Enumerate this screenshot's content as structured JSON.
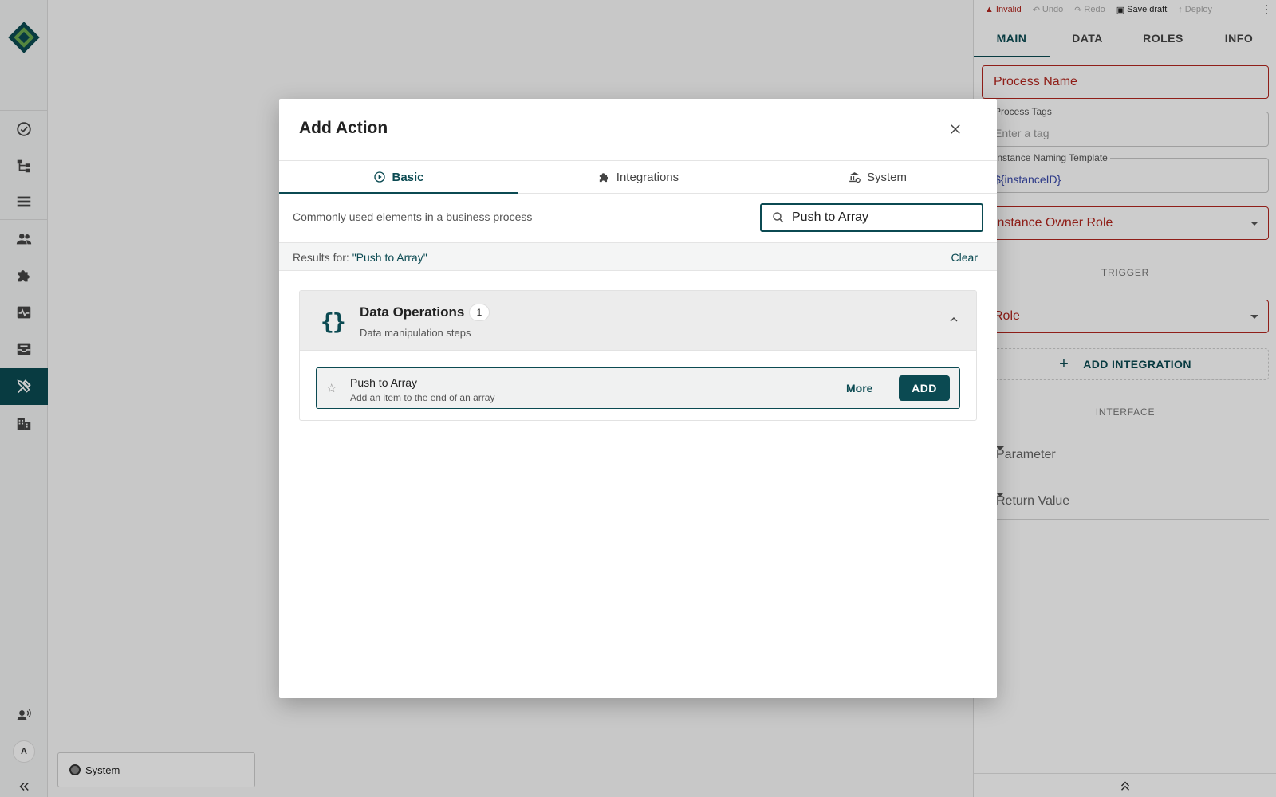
{
  "sidebar": {
    "items": [
      {
        "icon": "check-circle-icon"
      },
      {
        "icon": "process-tree-icon"
      },
      {
        "icon": "list-icon"
      },
      {
        "icon": "users-icon"
      },
      {
        "icon": "puzzle-icon"
      },
      {
        "icon": "activity-icon"
      },
      {
        "icon": "inbox-icon"
      },
      {
        "icon": "tools-icon",
        "active": true
      },
      {
        "icon": "building-icon"
      }
    ],
    "avatar": "A"
  },
  "canvas": {
    "system_chip": "System"
  },
  "panel": {
    "toolbar": {
      "invalid": "Invalid",
      "undo": "Undo",
      "redo": "Redo",
      "save_draft": "Save draft",
      "deploy": "Deploy"
    },
    "tabs": [
      "MAIN",
      "DATA",
      "ROLES",
      "INFO"
    ],
    "process_name": "Process Name",
    "process_tags_label": "Process Tags",
    "process_tags_placeholder": "Enter a tag",
    "naming_template_label": "Instance Naming Template",
    "naming_template_value": "${instanceID}",
    "instance_owner_role": "Instance Owner Role",
    "trigger_label": "TRIGGER",
    "role": "Role",
    "add_integration": "ADD INTEGRATION",
    "interface_label": "INTERFACE",
    "parameter": "Parameter",
    "return_value": "Return Value"
  },
  "modal": {
    "title": "Add Action",
    "tabs": [
      "Basic",
      "Integrations",
      "System"
    ],
    "description": "Commonly used elements in a business process",
    "search_value": "Push to Array",
    "results_prefix": "Results for:",
    "results_query": "\"Push to Array\"",
    "clear": "Clear",
    "group": {
      "title": "Data Operations",
      "count": "1",
      "subtitle": "Data manipulation steps",
      "icon": "{}"
    },
    "item": {
      "title": "Push to Array",
      "subtitle": "Add an item to the end of an array",
      "more": "More",
      "add": "ADD"
    }
  },
  "colors": {
    "accent": "#0b4a52",
    "error": "#b3261e"
  }
}
